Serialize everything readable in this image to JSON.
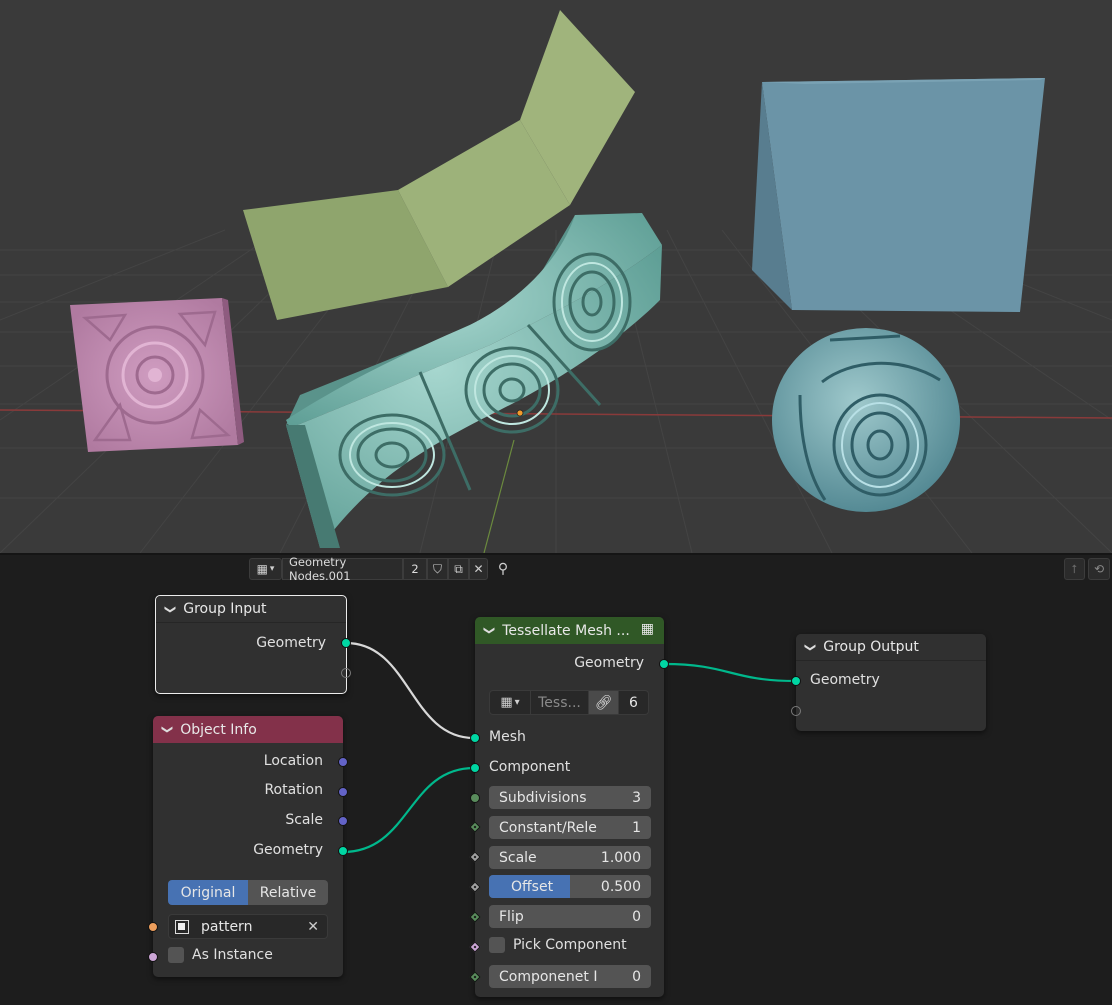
{
  "node_editor": {
    "header": {
      "tree_name": "Geometry Nodes.001",
      "users": "2"
    },
    "nodes": {
      "group_input": {
        "title": "Group Input",
        "outputs": [
          "Geometry"
        ]
      },
      "object_info": {
        "title": "Object Info",
        "outputs": [
          "Location",
          "Rotation",
          "Scale",
          "Geometry"
        ],
        "transform_mode": {
          "options": [
            "Original",
            "Relative"
          ],
          "selected": "Original"
        },
        "object_field": "pattern",
        "as_instance_label": "As Instance"
      },
      "tessellate": {
        "title": "Tessellate Mesh ...",
        "output": "Geometry",
        "group_name": "Tess...",
        "group_users": "6",
        "inputs": {
          "mesh": "Mesh",
          "component": "Component",
          "subdivisions": {
            "label": "Subdivisions",
            "value": "3"
          },
          "constant": {
            "label": "Constant/Rele",
            "value": "1"
          },
          "scale": {
            "label": "Scale",
            "value": "1.000"
          },
          "offset": {
            "label": "Offset",
            "value": "0.500",
            "fill": 0.5
          },
          "flip": {
            "label": "Flip",
            "value": "0"
          },
          "pick_component": {
            "label": "Pick Component"
          },
          "component_index": {
            "label": "Componenet I",
            "value": "0"
          }
        }
      },
      "group_output": {
        "title": "Group Output",
        "inputs": [
          "Geometry"
        ]
      }
    }
  },
  "colors": {
    "geometry_socket": "#00d6a3",
    "vector_socket": "#6363c7",
    "object_socket": "#ed9e5c",
    "boolean_socket": "#cca6d6",
    "int_socket": "#598c5c",
    "object_info_header": "#83314a",
    "tessellate_header": "#305826",
    "viewport_bg": "#3a3a3a",
    "editor_bg": "#1d1d1d",
    "accent_blue": "#4772b3"
  }
}
